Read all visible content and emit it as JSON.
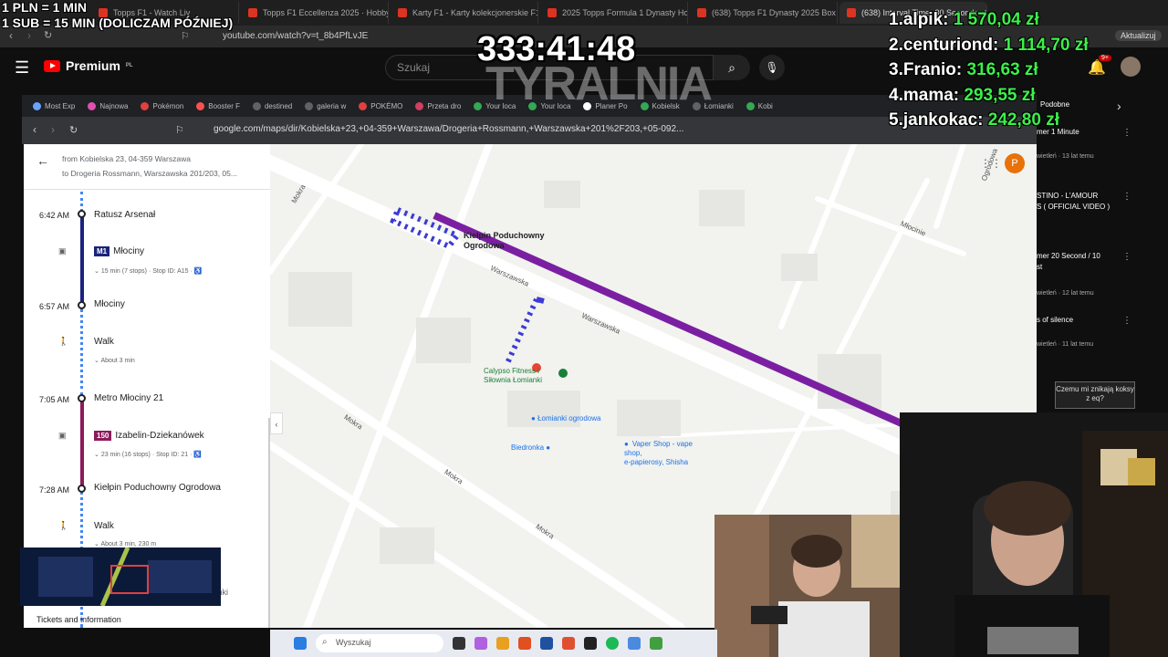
{
  "outer_browser": {
    "tabs": [
      {
        "label": "Topps F1 - Watch Liv",
        "active": false
      },
      {
        "label": "Topps F1 Eccellenza 2025 · Hobby Bo",
        "active": false
      },
      {
        "label": "Karty F1 - Karty kolekcjonerskie F1 -",
        "active": false
      },
      {
        "label": "2025 Topps Formula 1 Dynasty Hobb",
        "active": false
      },
      {
        "label": "(638) Topps F1 Dynasty 2025 Box Op",
        "active": false
      },
      {
        "label": "(638) Interval Timer 30 Seconds",
        "active": true
      }
    ],
    "url": "youtube.com/watch?v=t_8b4PfLvJE",
    "update_label": "Aktualizuj"
  },
  "youtube": {
    "logo_text": "Premium",
    "logo_sup": "PL",
    "search_placeholder": "Szukaj",
    "notif_count": "9+",
    "sidebar_items": [
      {
        "title": "Podobne",
        "meta": ""
      },
      {
        "title": "mer 1 Minute",
        "meta": "wietleń · 13 lat temu"
      },
      {
        "title": "STINO - L'AMOUR",
        "meta": ""
      },
      {
        "title": "S ( OFFICIAL VIDEO )",
        "meta": ""
      },
      {
        "title": "mer 20 Second / 10",
        "meta": ""
      },
      {
        "title": "st",
        "meta": "wietleń · 12 lat temu"
      },
      {
        "title": "s of silence",
        "meta": "wietleń · 11 lat temu"
      }
    ]
  },
  "overlays": {
    "top_left_line1": "1 PLN = 1 MIN",
    "top_left_line2": "1 SUB = 15 MIN (DOLICZAM PÓŹNIEJ)",
    "timer": "333:41:48",
    "brand": "TYRALNIA",
    "leaderboard": [
      {
        "rank": "1.",
        "name": "alpik:",
        "amount": "1 570,04 zł"
      },
      {
        "rank": "2.",
        "name": "centuriond:",
        "amount": "1 114,70 zł"
      },
      {
        "rank": "3.",
        "name": "Franio:",
        "amount": "316,63 zł"
      },
      {
        "rank": "4.",
        "name": "mama:",
        "amount": "293,55 zł"
      },
      {
        "rank": "5.",
        "name": "jankokac:",
        "amount": "242,80 zł"
      }
    ],
    "chat_box": "Czemu mi znikają koksy z eq?"
  },
  "inner_browser": {
    "bookmarks": [
      {
        "label": "Most Exp",
        "color": "#6aa3ff"
      },
      {
        "label": "Najnowa",
        "color": "#e050b0"
      },
      {
        "label": "Pokémon",
        "color": "#e04040"
      },
      {
        "label": "Booster F",
        "color": "#ff5050"
      },
      {
        "label": "destined",
        "color": "#5f6368"
      },
      {
        "label": "galeria w",
        "color": "#5f6368"
      },
      {
        "label": "POKÉMO",
        "color": "#e04040"
      },
      {
        "label": "Przeta dro",
        "color": "#d04060"
      },
      {
        "label": "Your loca",
        "color": "#34a853"
      },
      {
        "label": "Your loca",
        "color": "#34a853"
      },
      {
        "label": "Planer Po",
        "color": "#ffffff"
      },
      {
        "label": "Kobielsk",
        "color": "#34a853"
      },
      {
        "label": "Łomianki",
        "color": "#5f6368"
      },
      {
        "label": "Kobi",
        "color": "#34a853"
      }
    ],
    "url": "google.com/maps/dir/Kobielska+23,+04-359+Warszawa/Drogeria+Rossmann,+Warszawska+201%2F203,+05-092..."
  },
  "maps_panel": {
    "from": "from Kobielska 23, 04-359 Warszawa",
    "to": "to Drogeria Rossmann, Warszawska 201/203, 05...",
    "steps": [
      {
        "time": "6:42 AM",
        "stop": "Ratusz Arsenał"
      },
      {
        "line": "M1",
        "line_color": "#1a237e",
        "dest": "Młociny",
        "info": "15 min (7 stops) · Stop ID: A15 · ♿"
      },
      {
        "time": "6:57 AM",
        "stop": "Młociny"
      },
      {
        "walk": "Walk",
        "info": "About 3 min"
      },
      {
        "time": "7:05 AM",
        "stop": "Metro Młociny 21"
      },
      {
        "line": "150",
        "line_color": "#8e1b5c",
        "dest": "Izabelin-Dziekanówek",
        "info": "23 min (16 stops) · Stop ID: 21 · ♿"
      },
      {
        "time": "7:28 AM",
        "stop": "Kiełpin Poduchowny Ogrodowa"
      },
      {
        "walk": "Walk",
        "info": "About 3 min, 230 m"
      }
    ],
    "end_label": "Łomianki",
    "tickets": "Tickets and information"
  },
  "map": {
    "stop_label_1": "Kiełpin Poduchowny",
    "stop_label_2": "Ogrodowa",
    "poi_calypso_1": "Calypso Fitness i",
    "poi_calypso_2": "Siłownia Łomianki",
    "poi_lomianki": "Łomianki ogrodowa",
    "poi_biedronka": "Biedronka",
    "poi_vape_1": "Vaper Shop - vape shop,",
    "poi_vape_2": "e-papierosy, Shisha",
    "road_warszawska_1": "Warszawska",
    "road_warszawska_2": "Warszawska",
    "road_mokra_1": "Mokra",
    "road_mokra_2": "Mokra",
    "road_mokra_3": "Mokra",
    "road_mokra_4": "Mokra",
    "road_mlocinie": "Młocinie",
    "road_ogrodowa": "Ogrodowa",
    "user_initial": "P"
  },
  "taskbar": {
    "search_placeholder": "Wyszukaj"
  }
}
